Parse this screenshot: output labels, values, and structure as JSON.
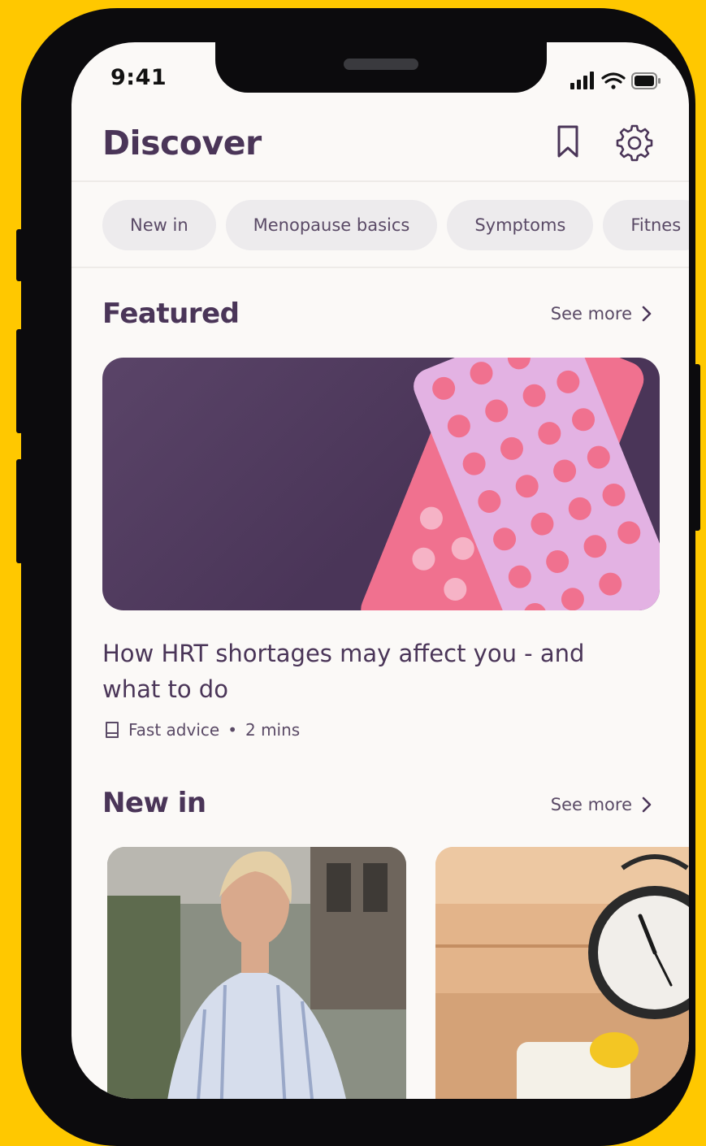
{
  "status_bar": {
    "time": "9:41"
  },
  "header": {
    "title": "Discover"
  },
  "chips": [
    "New in",
    "Menopause basics",
    "Symptoms",
    "Fitnes"
  ],
  "featured": {
    "title": "Featured",
    "see_more": "See more",
    "article": {
      "title": "How HRT shortages may affect you - and what to do",
      "category": "Fast advice",
      "separator": "•",
      "duration": "2 mins"
    }
  },
  "new_in": {
    "title": "New in",
    "see_more": "See more"
  },
  "colors": {
    "background": "#FFC800",
    "brand_purple": "#4A3558",
    "pill_pink": "#F0718F",
    "pill_lilac": "#E3B2E3",
    "chip_bg": "#EDEBED"
  },
  "icons": {
    "header": [
      "bookmark-icon",
      "settings-gear-icon"
    ],
    "status": [
      "signal-icon",
      "wifi-icon",
      "battery-icon"
    ],
    "meta": "book-icon",
    "see_more": "chevron-right-icon"
  }
}
